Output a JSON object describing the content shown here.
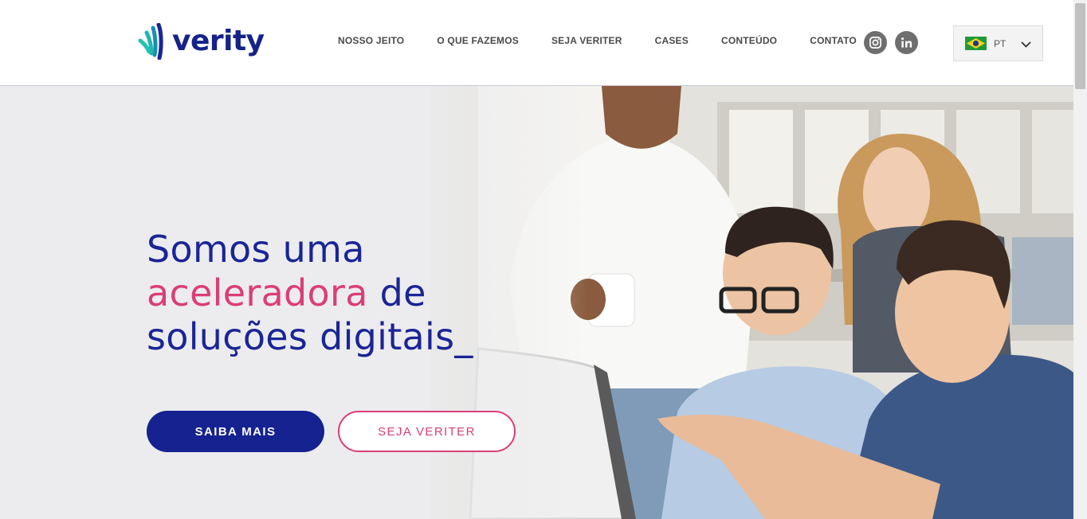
{
  "brand": {
    "name": "verity"
  },
  "nav": [
    {
      "label": "NOSSO JEITO"
    },
    {
      "label": "O QUE FAZEMOS"
    },
    {
      "label": "SEJA VERITER"
    },
    {
      "label": "CASES"
    },
    {
      "label": "CONTEÚDO"
    },
    {
      "label": "CONTATO"
    }
  ],
  "social": {
    "icons": [
      "instagram-icon",
      "linkedin-icon"
    ]
  },
  "language": {
    "code": "PT",
    "flag_icon": "brazil-flag-icon"
  },
  "hero": {
    "line1": "Somos uma",
    "line2_accent": "aceleradora",
    "line2_rest": " de",
    "line3": "soluções digitais_",
    "primary_button": "SAIBA MAIS",
    "secondary_button": "SEJA VERITER"
  },
  "colors": {
    "brand_blue": "#15228f",
    "accent_pink": "#db3d77",
    "teal": "#1fb5b5"
  }
}
